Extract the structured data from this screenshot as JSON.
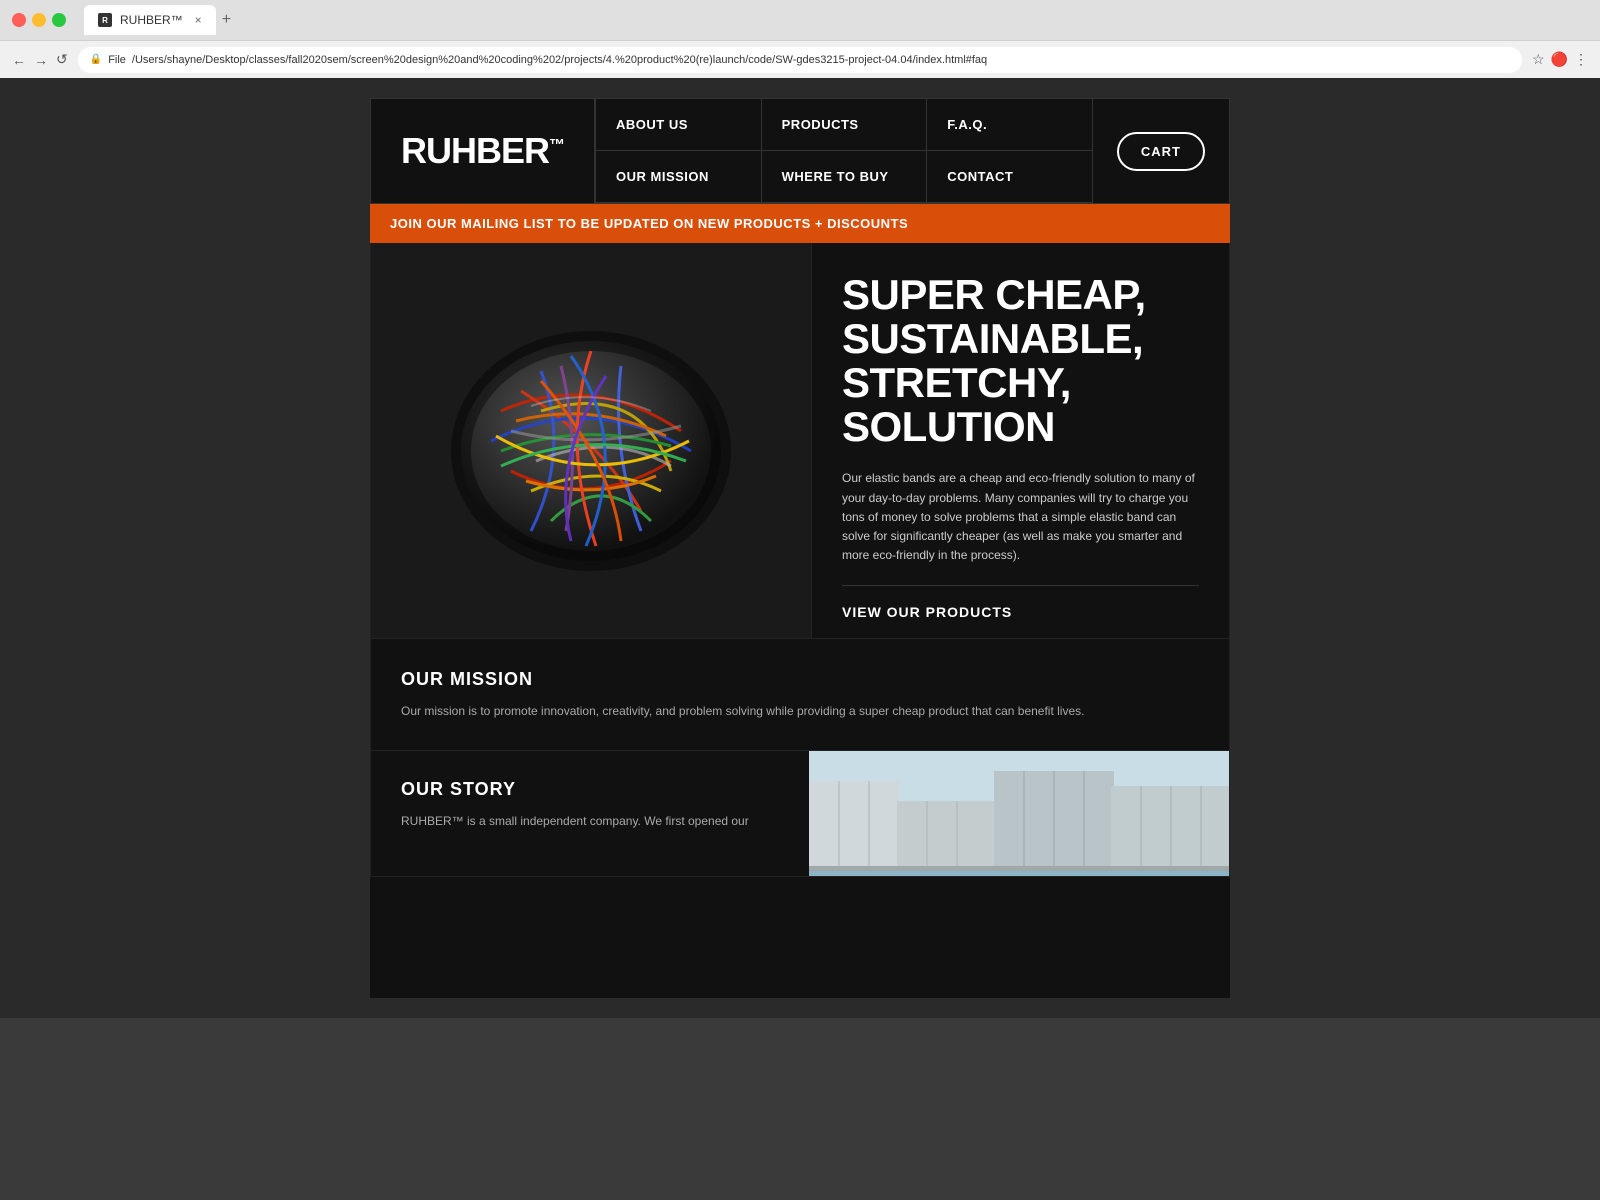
{
  "browser": {
    "tab_title": "RUHBER™",
    "tab_new_label": "+",
    "tab_close_label": "×",
    "address": "/Users/shayne/Desktop/classes/fall2020sem/screen%20design%20and%20coding%202/projects/4.%20product%20(re)launch/code/SW-gdes3215-project-04.04/index.html#faq",
    "address_prefix": "File",
    "back_icon": "←",
    "forward_icon": "→",
    "refresh_icon": "↺"
  },
  "nav": {
    "logo": "RUHBER",
    "logo_tm": "™",
    "items": [
      {
        "label": "ABOUT US",
        "id": "about-us"
      },
      {
        "label": "PRODUCTS",
        "id": "products"
      },
      {
        "label": "F.A.Q.",
        "id": "faq"
      },
      {
        "label": "OUR MISSION",
        "id": "our-mission"
      },
      {
        "label": "WHERE TO BUY",
        "id": "where-to-buy"
      },
      {
        "label": "CONTACT",
        "id": "contact"
      }
    ],
    "cart_label": "CART"
  },
  "banner": {
    "text": "JOIN OUR MAILING LIST TO BE UPDATED ON NEW PRODUCTS + DISCOUNTS"
  },
  "hero": {
    "headline": "SUPER CHEAP, SUSTAINABLE, STRETCHY, SOLUTION",
    "body": "Our elastic bands are a cheap and eco-friendly solution to many of your day-to-day problems. Many companies will try to charge you tons of money to solve problems that a simple elastic band can solve for significantly cheaper (as well as make you smarter and more eco-friendly in the process).",
    "cta_label": "VIEW OUR PRODUCTS"
  },
  "mission": {
    "title": "OUR MISSION",
    "body": "Our mission is to promote innovation, creativity, and problem solving while providing a super cheap product that can benefit lives."
  },
  "story": {
    "title": "OUR STORY",
    "body": "RUHBER™ is a small independent company. We first opened our"
  },
  "colors": {
    "background": "#3a3a3a",
    "site_bg": "#111111",
    "banner_bg": "#d94f0a",
    "accent": "#e05520",
    "text_white": "#ffffff",
    "text_muted": "#aaaaaa"
  }
}
